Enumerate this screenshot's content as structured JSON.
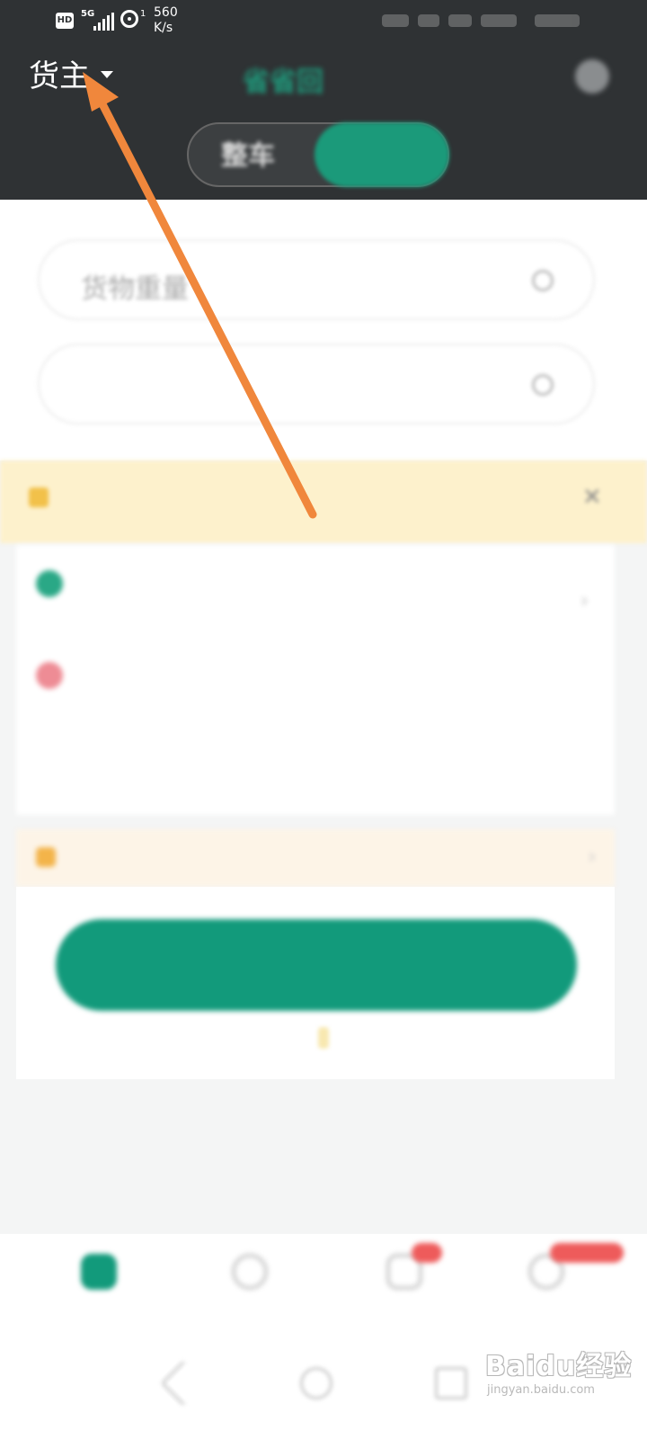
{
  "status_bar": {
    "hd": "HD",
    "network": "5G",
    "signal_sub": "1",
    "speed_value": "560",
    "speed_unit": "K/s"
  },
  "header": {
    "role_label": "货主",
    "app_title": "省省回",
    "segment": {
      "left_label": "整车",
      "right_label": ""
    }
  },
  "form": {
    "weight_label": "货物重量",
    "type_label": ""
  },
  "notice": {
    "text": "",
    "icon": "notice-icon"
  },
  "route": {
    "from_text": "",
    "from_sub": "",
    "to_text": ""
  },
  "insurance": {
    "text": ""
  },
  "submit": {
    "label": "",
    "note_before": "",
    "note_highlight": "",
    "note_after": ""
  },
  "recent": {
    "title": "",
    "more": ""
  },
  "tabs": [
    {
      "label": "",
      "color": "#129a7b",
      "icon": "home-icon"
    },
    {
      "label": "",
      "color": "#cccccc",
      "icon": "orders-icon"
    },
    {
      "label": "",
      "color": "#cccccc",
      "icon": "message-icon"
    },
    {
      "label": "",
      "color": "#cccccc",
      "icon": "profile-icon"
    }
  ],
  "watermark": {
    "main": "Baidu经验",
    "sub": "jingyan.baidu.com"
  },
  "colors": {
    "header_bg": "#2f3234",
    "brand_green": "#129a7b",
    "annotation_arrow": "#f0873c"
  }
}
